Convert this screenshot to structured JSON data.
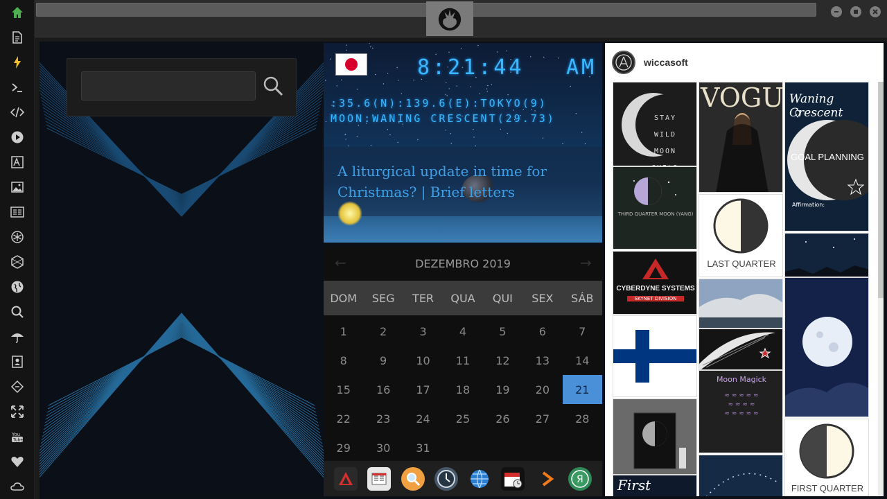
{
  "sidebar": {
    "icons": [
      "home-icon",
      "document-icon",
      "lightning-icon",
      "terminal-icon",
      "code-icon",
      "play-icon",
      "translate-icon",
      "image-icon",
      "newspaper-icon",
      "atom-icon",
      "hexagon-icon",
      "globe-icon",
      "search-icon",
      "umbrella-icon",
      "contact-card-icon",
      "diamond-code-icon",
      "fullscreen-icon",
      "youtube-icon",
      "heart-icon",
      "cloud-icon"
    ]
  },
  "colors": {
    "accent": "#4a90d9",
    "clock": "#39b8ff",
    "news": "#3ea0e8",
    "home": "#4caf50"
  },
  "clock": {
    "time": "8:21:44",
    "ampm": "AM",
    "location": ":35.6(N):139.6(E):TOKYO(9)",
    "moon": "MOON:WANING CRESCENT(29.73)"
  },
  "news": {
    "title": "A liturgical update in time for Christmas? | Brief letters"
  },
  "calendar": {
    "month": "DEZEMBRO 2019",
    "days_of_week": [
      "DOM",
      "SEG",
      "TER",
      "QUA",
      "QUI",
      "SEX",
      "SÁB"
    ],
    "weeks": [
      [
        "1",
        "2",
        "3",
        "4",
        "5",
        "6",
        "7"
      ],
      [
        "8",
        "9",
        "10",
        "11",
        "12",
        "13",
        "14"
      ],
      [
        "15",
        "16",
        "17",
        "18",
        "19",
        "20",
        "21"
      ],
      [
        "22",
        "23",
        "24",
        "25",
        "26",
        "27",
        "28"
      ],
      [
        "29",
        "30",
        "31",
        "",
        "",
        "",
        ""
      ]
    ],
    "today": "21"
  },
  "dock": {
    "items": [
      "rebel-app-icon",
      "news-app-icon",
      "search-app-icon",
      "clock-app-icon",
      "globe-app-icon",
      "calendar-app-icon",
      "arrow-app-icon",
      "yandex-app-icon"
    ]
  },
  "pinterest": {
    "user": "wiccasoft",
    "tiles": {
      "stay_wild": "STAY WILD MOON CHILD",
      "vogue": "VOGUE",
      "waning": "Waning Crescent",
      "goal": "GOAL PLANNING",
      "affirm": "Affirmation:",
      "third": "THIRD QUARTER MOON (YANG)",
      "last_quarter": "LAST QUARTER",
      "cyberdyne": "CYBERDYNE SYSTEMS",
      "skynet": "SKYNET DIVISION",
      "moon_magick": "Moon Magick",
      "first_quarter_script": "First Quarter",
      "first_quarter": "FIRST QUARTER"
    }
  }
}
